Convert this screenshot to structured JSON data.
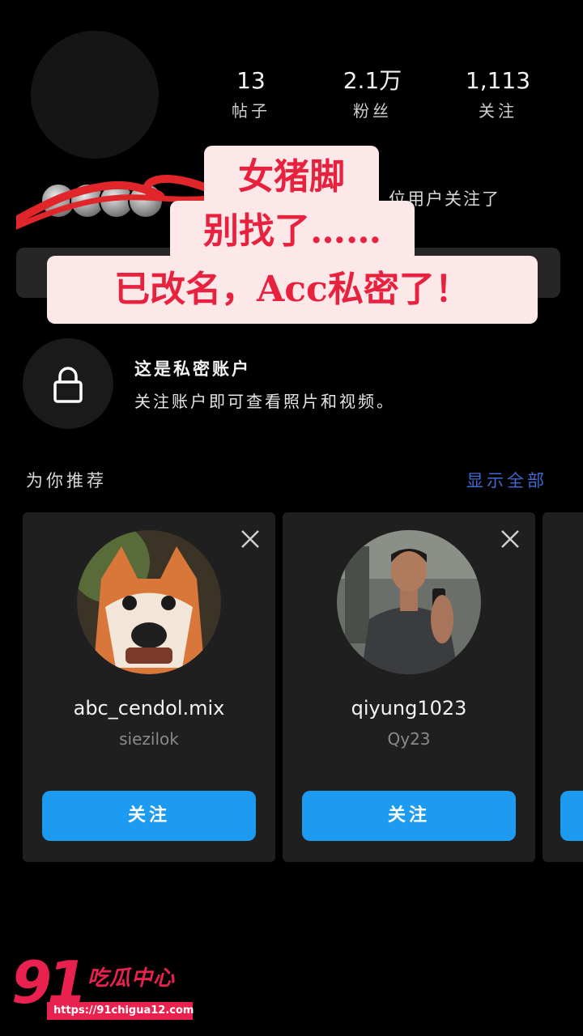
{
  "profile": {
    "stats": [
      {
        "value": "13",
        "label": "帖子"
      },
      {
        "value": "2.1万",
        "label": "粉丝"
      },
      {
        "value": "1,113",
        "label": "关注"
      }
    ],
    "followed_by_text": "位用户关注了"
  },
  "overlay": {
    "line1": "女猪脚",
    "line2": "别找了……",
    "line3": "已改名，Acc私密了！"
  },
  "private": {
    "title": "这是私密账户",
    "description": "关注账户即可查看照片和视频。"
  },
  "suggestions": {
    "title": "为你推荐",
    "show_all": "显示全部",
    "cards": [
      {
        "username": "abc_cendol.mix",
        "fullname": "siezilok",
        "follow_label": "关注"
      },
      {
        "username": "qiyung1023",
        "fullname": "Qy23",
        "follow_label": "关注"
      }
    ]
  },
  "watermark": {
    "number": "91",
    "name": "吃瓜中心",
    "url": "https://91chigua12.com"
  },
  "colors": {
    "background": "#000000",
    "accent_blue": "#1d9bf0",
    "overlay_red": "#e8213e",
    "overlay_bg": "#fce8e8"
  }
}
